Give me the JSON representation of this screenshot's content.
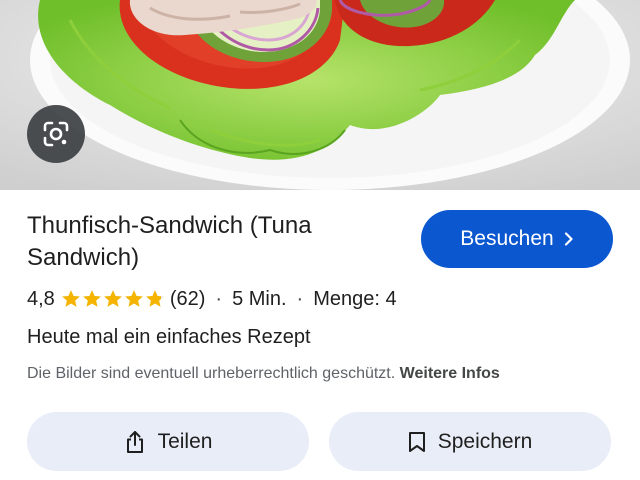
{
  "recipe": {
    "title": "Thunfisch-Sandwich (Tuna Sandwich)",
    "rating_value": "4,8",
    "rating_stars": 4.8,
    "review_count": "(62)",
    "time": "5 Min.",
    "yield": "Menge: 4",
    "separator": "·",
    "description": "Heute mal ein einfaches Rezept"
  },
  "visit_button": {
    "label": "Besuchen",
    "icon": "chevron-right-icon",
    "color": "#0b57d0"
  },
  "hero": {
    "lens_icon": "lens-search-icon"
  },
  "notice": {
    "text": "Die Bilder sind eventuell urheberrechtlich geschützt.",
    "link": "Weitere Infos"
  },
  "actions": {
    "share_label": "Teilen",
    "share_icon": "share-icon",
    "save_label": "Speichern",
    "save_icon": "bookmark-icon"
  },
  "colors": {
    "star": "#f4b400",
    "button_bg": "#e8edf7"
  }
}
